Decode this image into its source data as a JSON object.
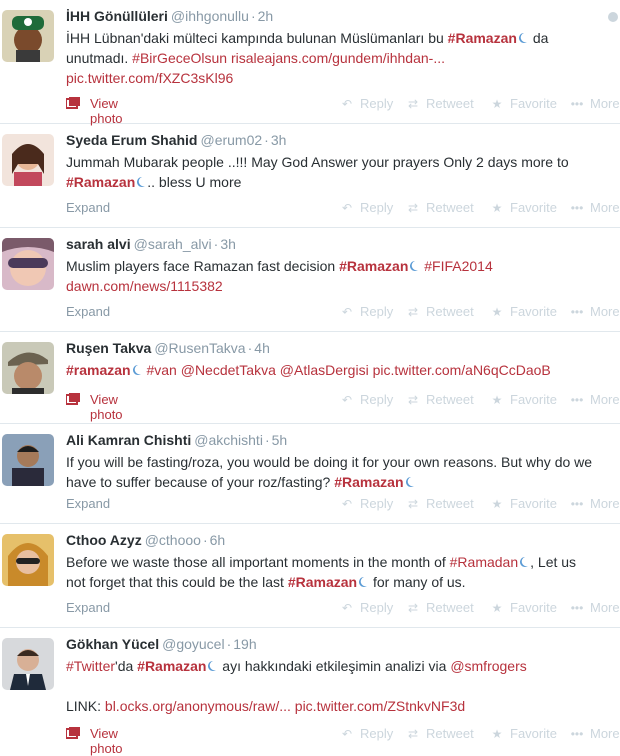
{
  "actions": {
    "reply": "Reply",
    "retweet": "Retweet",
    "favorite": "Favorite",
    "more": "More"
  },
  "tweets": [
    {
      "name": "İHH Gönüllüleri",
      "handle": "@ihhgonullu",
      "time": "2h",
      "line1_a": "İHH Lübnan'daki mülteci kampında bulunan Müslümanları bu ",
      "line1_hash": "#Ramazan",
      "line1_b": " da",
      "line2_a": "unutmadı. ",
      "line2_hash": "#BirGeceOlsun",
      "line2_link": " risaleajans.com/gundem/ihhdan-...",
      "line3_link": "pic.twitter.com/fXZC3sKl96",
      "footer": "View photo"
    },
    {
      "name": "Syeda Erum Shahid",
      "handle": "@erum02",
      "time": "3h",
      "line1": "Jummah Mubarak people ..!!! May God Answer your prayers Only 2 days more to",
      "line2_hash": "#Ramazan",
      "line2_b": ".. bless U more",
      "footer": "Expand"
    },
    {
      "name": "sarah alvi",
      "handle": "@sarah_alvi",
      "time": "3h",
      "line1_a": "Muslim players face Ramazan fast decision ",
      "line1_hash": "#Ramazan",
      "line1_hash2": " #FIFA2014",
      "line2_link": "dawn.com/news/1115382",
      "footer": "Expand"
    },
    {
      "name": "Ruşen Takva",
      "handle": "@RusenTakva",
      "time": "4h",
      "line1_hash": "#ramazan",
      "line1_hash2": " #van",
      "line1_m1": " @NecdetTakva",
      "line1_m2": " @AtlasDergisi",
      "line1_link": " pic.twitter.com/aN6qCcDaoB",
      "footer": "View photo"
    },
    {
      "name": "Ali Kamran Chishti",
      "handle": "@akchishti",
      "time": "5h",
      "line1": "If you will be fasting/roza, you would be doing it for your own reasons. But why do we",
      "line2_a": "have to suffer because of your roz/fasting? ",
      "line2_hash": "#Ramazan",
      "footer": "Expand"
    },
    {
      "name": "Cthoo Azyz",
      "handle": "@cthooo",
      "time": "6h",
      "line1_a": "Before we waste those all important moments in the month of ",
      "line1_hash": "#Ramadan",
      "line1_b": ", Let us",
      "line2_a": "not forget that this could be the last ",
      "line2_hash": "#Ramazan",
      "line2_b": " for many of us.",
      "footer": "Expand"
    },
    {
      "name": "Gökhan Yücel",
      "handle": "@goyucel",
      "time": "19h",
      "line1_hash": "#Twitter",
      "line1_a": "'da ",
      "line1_hash2": "#Ramazan",
      "line1_b": " ayı hakkındaki etkileşimin analizi via ",
      "line1_m1": "@smfrogers",
      "line3_a": "LINK: ",
      "line3_link": "bl.ocks.org/anonymous/raw/...",
      "line3_link2": " pic.twitter.com/ZStnkvNF3d",
      "footer": "View photo"
    }
  ]
}
